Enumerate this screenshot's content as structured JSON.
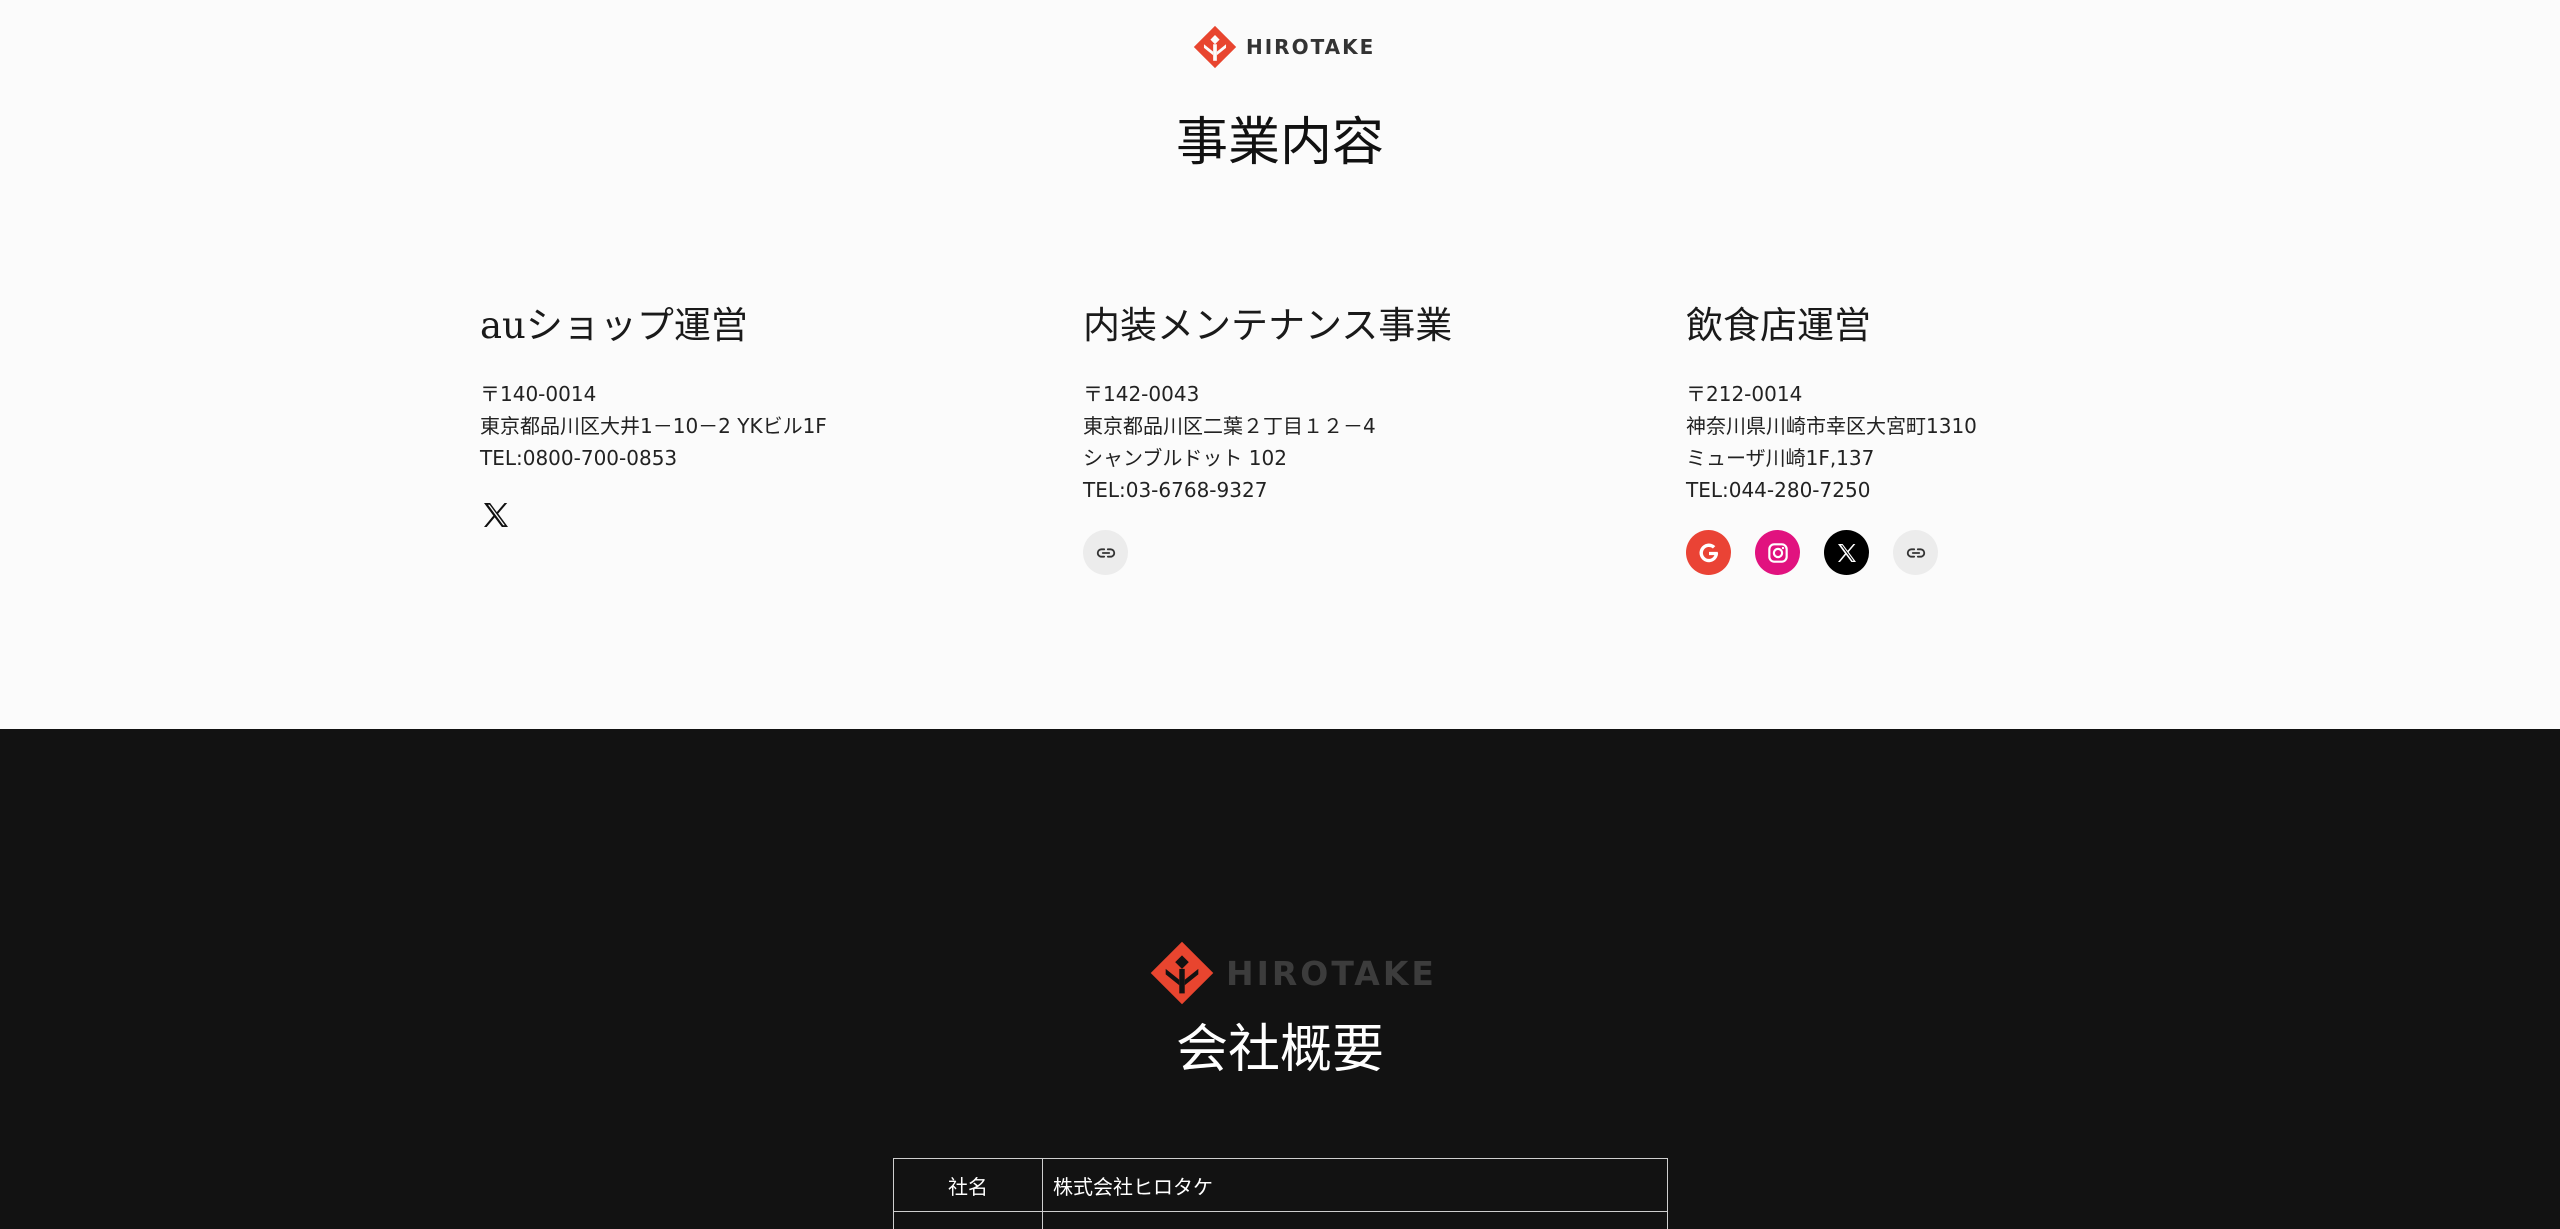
{
  "header": {
    "logo_text": "HIROTAKE",
    "section_title": "事業内容"
  },
  "businesses": [
    {
      "title": "auショップ運営",
      "lines": [
        "〒140-0014",
        "東京都品川区大井1－10－2 YKビル1F",
        "TEL:0800-700-0853"
      ],
      "links": [
        {
          "icon": "x-icon"
        }
      ]
    },
    {
      "title": "内装メンテナンス事業",
      "lines": [
        "〒142-0043",
        "東京都品川区二葉２丁目１２－4",
        "シャンブルドット 102",
        "TEL:03-6768-9327"
      ],
      "links": [
        {
          "icon": "link-icon"
        }
      ]
    },
    {
      "title": "飲食店運営",
      "lines": [
        "〒212-0014",
        "神奈川県川崎市幸区大宮町1310",
        "ミューザ川崎1F,137",
        "TEL:044-280-7250"
      ],
      "links": [
        {
          "icon": "google-icon"
        },
        {
          "icon": "instagram-icon"
        },
        {
          "icon": "x-icon"
        },
        {
          "icon": "link-icon"
        }
      ]
    }
  ],
  "company": {
    "logo_text": "HIROTAKE",
    "section_title": "会社概要",
    "profile": [
      {
        "label": "社名",
        "value": "株式会社ヒロタケ"
      }
    ]
  },
  "colors": {
    "brand_red": "#e8452f",
    "dark_bg": "#121212",
    "light_bg": "#fbfbfb",
    "instagram": "#e1127f",
    "google": "#ea4335"
  }
}
